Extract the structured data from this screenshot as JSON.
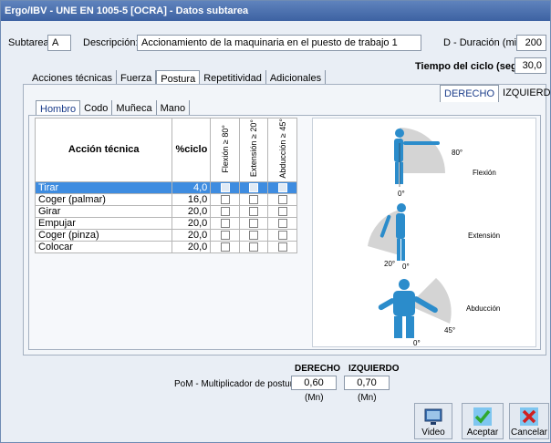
{
  "window": {
    "title": "Ergo/IBV - UNE EN 1005-5 [OCRA] - Datos subtarea"
  },
  "header": {
    "subtarea_label": "Subtarea:",
    "subtarea_value": "A",
    "descripcion_label": "Descripción:",
    "descripcion_value": "Accionamiento de la maquinaria en el puesto de trabajo 1",
    "duracion_label": "D - Duración (min):",
    "duracion_value": "200",
    "ciclo_label": "Tiempo del ciclo (seg):",
    "ciclo_value": "30,0"
  },
  "main_tabs": [
    {
      "label": "Acciones técnicas"
    },
    {
      "label": "Fuerza"
    },
    {
      "label": "Postura"
    },
    {
      "label": "Repetitividad"
    },
    {
      "label": "Adicionales"
    }
  ],
  "side_tabs": {
    "derecho": "DERECHO",
    "izquierdo": "IZQUIERDO"
  },
  "joint_tabs": [
    {
      "label": "Hombro"
    },
    {
      "label": "Codo"
    },
    {
      "label": "Muñeca"
    },
    {
      "label": "Mano"
    }
  ],
  "table": {
    "col_accion": "Acción técnica",
    "col_ciclo": "%ciclo",
    "col_flexion": "Flexión ≥ 80°",
    "col_extension": "Extensión ≥ 20°",
    "col_abduccion": "Abducción ≥ 45°",
    "rows": [
      {
        "accion": "Tirar",
        "ciclo": "4,0"
      },
      {
        "accion": "Coger (palmar)",
        "ciclo": "16,0"
      },
      {
        "accion": "Girar",
        "ciclo": "20,0"
      },
      {
        "accion": "Empujar",
        "ciclo": "20,0"
      },
      {
        "accion": "Coger (pinza)",
        "ciclo": "20,0"
      },
      {
        "accion": "Colocar",
        "ciclo": "20,0"
      }
    ]
  },
  "illustration": {
    "flexion_label": "Flexión",
    "flexion_top": "80°",
    "flexion_bottom": "0°",
    "extension_label": "Extensión",
    "extension_left": "20°",
    "extension_bottom": "0°",
    "abduccion_label": "Abducción",
    "abduccion_angle": "45°",
    "abduccion_bottom": "0°"
  },
  "pom": {
    "label": "PoM - Multiplicador de postura",
    "derecho_header": "DERECHO",
    "izquierdo_header": "IZQUIERDO",
    "derecho_value": "0,60",
    "izquierdo_value": "0,70",
    "derecho_unit": "(Mn)",
    "izquierdo_unit": "(Mn)"
  },
  "buttons": {
    "video": "Video",
    "aceptar": "Aceptar",
    "cancelar": "Cancelar"
  },
  "colors": {
    "title_bar": "#4a70b0",
    "selected_row": "#3e8ce0",
    "accent_green": "#2ea82e",
    "accent_red": "#d02020"
  }
}
